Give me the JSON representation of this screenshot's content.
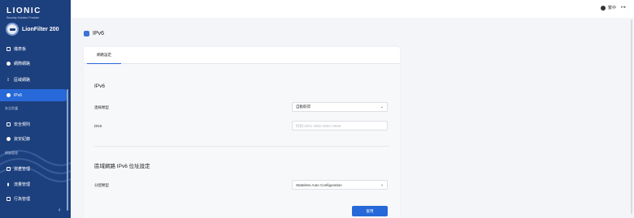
{
  "brand": {
    "name": "LIONIC",
    "tagline": "Security Solution Provider"
  },
  "device": {
    "name": "LionFilter 200"
  },
  "sidebar": {
    "items": [
      {
        "label": "儀表板",
        "icon": "dashboard-icon"
      },
      {
        "label": "網際網路",
        "icon": "globe-icon"
      },
      {
        "label": "區域網路",
        "icon": "network-icon"
      },
      {
        "label": "IPv6",
        "icon": "ipv6-icon",
        "active": true
      },
      {
        "label": "安全規則",
        "icon": "shield-icon"
      },
      {
        "label": "資安紀錄",
        "icon": "log-icon"
      },
      {
        "label": "資產管理",
        "icon": "asset-icon"
      },
      {
        "label": "流量管理",
        "icon": "chart-icon"
      },
      {
        "label": "行為管理",
        "icon": "grid-icon"
      }
    ],
    "sections": {
      "security": "安全防護",
      "network": "網路管理"
    }
  },
  "topbar": {
    "language": "繁中"
  },
  "page": {
    "title": "IPv6"
  },
  "tabs": [
    {
      "label": "網路設定"
    }
  ],
  "ipv6": {
    "title": "IPv6",
    "connection_type_label": "連線類型",
    "connection_type_value": "自動取得",
    "dns_label": "DNS",
    "dns_placeholder": "例如:2001:4860:4860::8888"
  },
  "lan": {
    "title": "區域網路 IPv6 位址設定",
    "assign_type_label": "分配類型",
    "assign_type_value": "Stateless Auto Configuration"
  },
  "apply_label": "套用",
  "colors": {
    "sidebar": "#1c3f7d",
    "accent": "#2769d8"
  }
}
